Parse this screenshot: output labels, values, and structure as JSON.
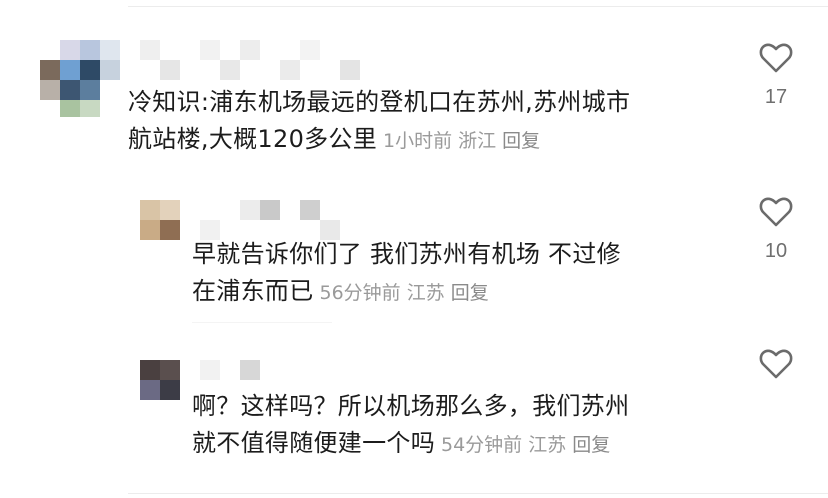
{
  "comments": [
    {
      "text": "冷知识:浦东机场最远的登机口在苏州,苏州城市航站楼,大概120多公里",
      "line1": "冷知识:浦东机场最远的登机口在苏州,苏州城市",
      "line2": "航站楼,大概120多公里",
      "time": "1小时前",
      "location": "浙江",
      "reply_label": "回复",
      "likes": "17"
    },
    {
      "text": "早就告诉你们了 我们苏州有机场 不过修在浦东而已",
      "line1": "早就告诉你们了 我们苏州有机场 不过修",
      "line2": "在浦东而已",
      "time": "56分钟前",
      "location": "江苏",
      "reply_label": "回复",
      "likes": "10"
    },
    {
      "text": "啊？这样吗？所以机场那么多，我们苏州就不值得随便建一个吗",
      "line1": "啊？这样吗？所以机场那么多，我们苏州",
      "line2": "就不值得随便建一个吗",
      "time": "54分钟前",
      "location": "江苏",
      "reply_label": "回复",
      "likes": ""
    }
  ],
  "icons": {
    "like": "heart-outline-icon"
  },
  "colors": {
    "text": "#1c1c1c",
    "meta": "#9a9a9a",
    "icon": "#6b6b6b"
  }
}
